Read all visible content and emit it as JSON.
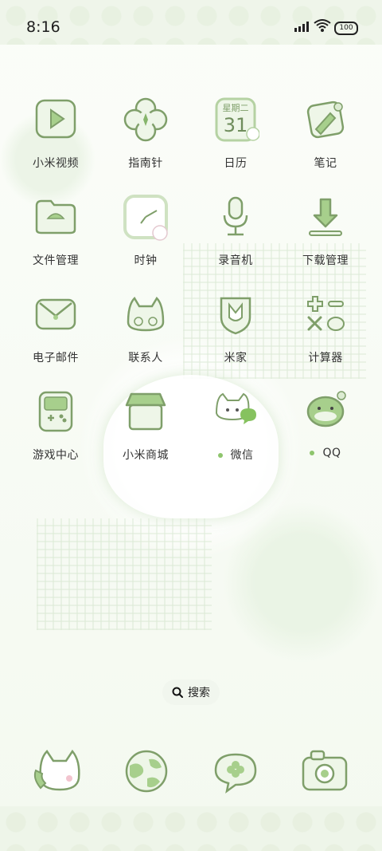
{
  "status_bar": {
    "time": "8:16",
    "battery": "100"
  },
  "apps": [
    {
      "label": "小米视频",
      "icon": "video-play-icon"
    },
    {
      "label": "指南针",
      "icon": "clover-compass-icon"
    },
    {
      "label": "日历",
      "icon": "calendar-icon",
      "weekday": "星期二",
      "day": "31"
    },
    {
      "label": "笔记",
      "icon": "notes-icon"
    },
    {
      "label": "文件管理",
      "icon": "folder-icon"
    },
    {
      "label": "时钟",
      "icon": "clock-icon"
    },
    {
      "label": "录音机",
      "icon": "microphone-icon"
    },
    {
      "label": "下载管理",
      "icon": "download-icon"
    },
    {
      "label": "电子邮件",
      "icon": "mail-icon"
    },
    {
      "label": "联系人",
      "icon": "cat-contacts-icon"
    },
    {
      "label": "米家",
      "icon": "home-shield-icon"
    },
    {
      "label": "计算器",
      "icon": "calculator-icon"
    },
    {
      "label": "游戏中心",
      "icon": "game-console-icon"
    },
    {
      "label": "小米商城",
      "icon": "shop-icon"
    },
    {
      "label": "微信",
      "icon": "wechat-cat-icon",
      "dot": true
    },
    {
      "label": "QQ",
      "icon": "qq-frog-icon",
      "dot": true
    }
  ],
  "search": {
    "label": "搜索"
  },
  "dock": [
    {
      "icon": "phone-cat-icon"
    },
    {
      "icon": "browser-globe-icon"
    },
    {
      "icon": "messages-clover-icon"
    },
    {
      "icon": "camera-icon"
    }
  ],
  "colors": {
    "accent": "#8ec56d",
    "icon_stroke": "#7f9f6a",
    "icon_fill": "#dcebd2"
  }
}
